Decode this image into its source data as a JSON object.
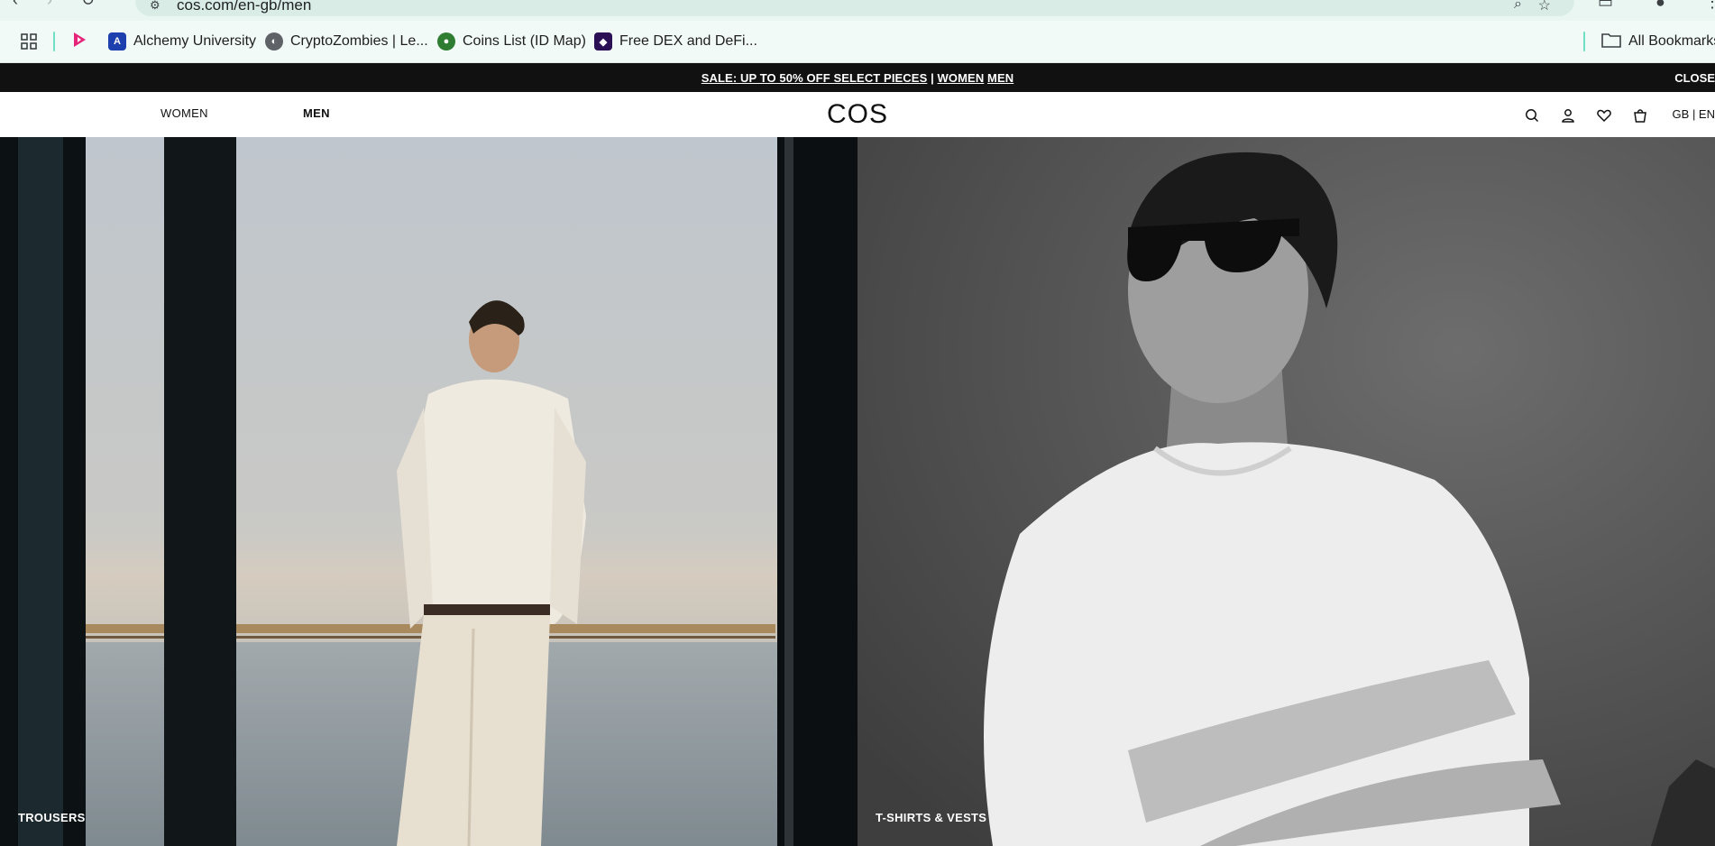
{
  "browser": {
    "url": "cos.com/en-gb/men",
    "bookmarks": [
      {
        "label": "",
        "icon": "apps-grid-icon"
      },
      {
        "label": "",
        "icon": "play-icon"
      },
      {
        "label": "Alchemy University",
        "icon": "alchemy-icon"
      },
      {
        "label": "CryptoZombies | Le...",
        "icon": "globe-icon"
      },
      {
        "label": "Coins List (ID Map)",
        "icon": "coin-icon"
      },
      {
        "label": "Free DEX and DeFi...",
        "icon": "dex-icon"
      }
    ],
    "all_bookmarks": "All Bookmarks"
  },
  "promo": {
    "sale_text": "SALE: UP TO 50% OFF SELECT PIECES",
    "divider": "|",
    "women": "WOMEN",
    "men": "MEN",
    "close": "CLOSE"
  },
  "header": {
    "women": "WOMEN",
    "men": "MEN",
    "logo": "COS",
    "locale": "GB | EN"
  },
  "hero": {
    "left_caption": "TROUSERS",
    "right_caption": "T-SHIRTS & VESTS"
  },
  "colors": {
    "promo_bg": "#111111",
    "chrome_bg": "#eaf6f1"
  }
}
